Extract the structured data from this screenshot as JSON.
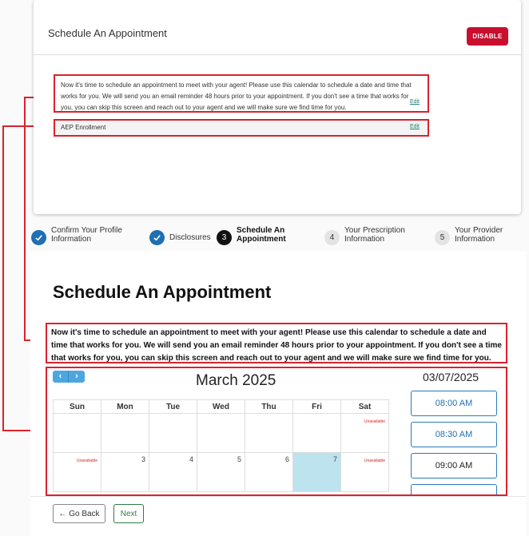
{
  "settings": {
    "title": "Schedule An Appointment",
    "disable_label": "DISABLE",
    "message": "Now it's time to schedule an appointment to meet with your agent! Please use this calendar to schedule a date and time that works for you. We will send you an email reminder 48 hours prior to your appointment. If you don't see a time that works for you, you can skip this screen and reach out to your agent and we will make sure we find time for you.",
    "message_edit": "Edit",
    "enrollment_label": "AEP Enrollment",
    "enrollment_edit": "Edit"
  },
  "stepper": {
    "steps": [
      {
        "label": "Confirm Your Profile Information",
        "state": "done",
        "icon": "check-icon"
      },
      {
        "label": "Disclosures",
        "state": "done",
        "icon": "check-icon"
      },
      {
        "label": "Schedule An Appointment",
        "state": "active",
        "number": "3"
      },
      {
        "label": "Your Prescription Information",
        "state": "todo",
        "number": "4"
      },
      {
        "label": "Your Provider Information",
        "state": "todo",
        "number": "5"
      }
    ]
  },
  "main": {
    "heading": "Schedule An Appointment",
    "message": "Now it's time to schedule an appointment to meet with your agent! Please use this calendar to schedule a date and time that works for you. We will send you an email reminder 48 hours prior to your appointment. If you don't see a time that works for you, you can skip this screen and reach out to your agent and we will make sure we find time for you."
  },
  "calendar": {
    "prev_icon": "chevron-left-icon",
    "next_icon": "chevron-right-icon",
    "prev_symbol": "‹",
    "next_symbol": "›",
    "month_title": "March 2025",
    "selected_date": "03/07/2025",
    "weekdays": [
      "Sun",
      "Mon",
      "Tue",
      "Wed",
      "Thu",
      "Fri",
      "Sat"
    ],
    "weeks": [
      [
        "",
        "",
        "",
        "",
        "",
        "",
        "Unavailable"
      ],
      [
        "Unavailable",
        "3",
        "4",
        "5",
        "6",
        "7",
        "Unavailable"
      ]
    ],
    "unavailable_label": "Unavailable",
    "today_cell": "7",
    "time_slots": [
      "08:00 AM",
      "08:30 AM",
      "09:00 AM",
      ""
    ]
  },
  "footer": {
    "back_label": "← Go Back",
    "next_label": "Next"
  },
  "colors": {
    "highlight": "#d9232e",
    "primary_blue": "#1f6fb2",
    "disable_red": "#c8102e",
    "today_fill": "#bde3ee",
    "next_green": "#2e7d46"
  }
}
